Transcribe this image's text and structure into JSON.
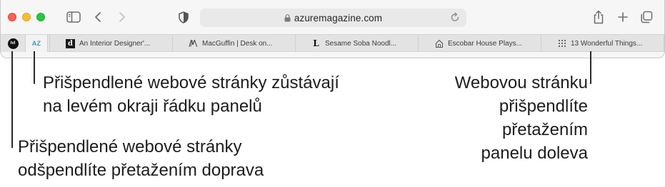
{
  "toolbar": {
    "url": "azuremagazine.com",
    "traffic_lights": {
      "close": "#ff5f57",
      "minimize": "#febc2e",
      "maximize": "#28c840"
    }
  },
  "pinned_tabs": [
    {
      "badge": "lvl"
    },
    {
      "badge": "AZ",
      "color": "#2e9bd6"
    }
  ],
  "tabs": [
    {
      "favicon": "d",
      "title": "An Interior Designer'..."
    },
    {
      "favicon": "macguffin-logo-icon",
      "title": "MacGuffin | Desk on..."
    },
    {
      "favicon": "L",
      "title": "Sesame Soba Noodl..."
    },
    {
      "favicon": "house-icon",
      "title": "Escobar House Plays..."
    },
    {
      "favicon": "grid-icon",
      "title": "13 Wonderful Things..."
    }
  ],
  "callouts": {
    "pinned_stay": [
      "Přišpendlené webové stránky zůstávají",
      "na levém okraji řádku panelů"
    ],
    "unpin": [
      "Přišpendlené webové stránky",
      "odšpendlíte přetažením doprava"
    ],
    "pin": [
      "Webovou stránku",
      "přišpendlíte",
      "přetažením",
      "panelu doleva"
    ]
  }
}
